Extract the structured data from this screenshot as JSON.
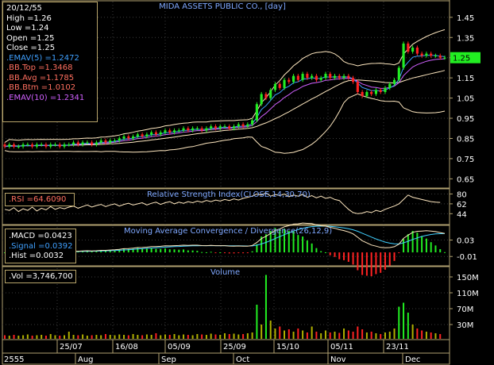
{
  "colors": {
    "background": "#000000",
    "frame": "#b0a070",
    "grid": "#3a3a3a",
    "title": "#7fa8ff",
    "candle_up": "#22ee22",
    "candle_down": "#ff2222",
    "ema5": "#3fa0ff",
    "ema10": "#d060ff",
    "bb": "#ffe8c0",
    "rsi": "#ffe8c0",
    "macd": "#ffe8c0",
    "signal": "#40d0ff",
    "hist_pos": "#22ee22",
    "hist_neg": "#ff2222",
    "vol_up": "#22ee22",
    "vol_down": "#ff2222",
    "vol_other": "#b0b000",
    "price_tag": "#22ee22"
  },
  "chart": {
    "title": "MIDA ASSETS PUBLIC CO., [day]",
    "rsi_title": "Relative Strength Index(CLOSE,14,30,70)",
    "macd_title": "Moving Average Convergence / Divergence(26,12,9)",
    "volume_title": "Volume",
    "price_tag": "1.25"
  },
  "info": {
    "date": "20/12/55",
    "high": "High  =1.26",
    "low": "Low   =1.24",
    "open": "Open  =1.25",
    "close": "Close  =1.25",
    "ema5": ".EMAV(5)    =1.2472",
    "bbtop": ".BB.Top    =1.3468",
    "bbavg": ".BB.Avg    =1.1785",
    "bbbtm": ".BB.Btm    =1.0102",
    "ema10": ".EMAV(10)  =1.2341"
  },
  "rsi_box": {
    "label": ".RSI   =64.6090"
  },
  "macd_box": {
    "macd": ".MACD  =0.0423",
    "signal": ".Signal  =0.0392",
    "hist": ".Hist  =0.0032"
  },
  "vol_box": {
    "label": ".Vol   =3,746,700"
  },
  "chart_data": {
    "type": "line",
    "price_axis": {
      "ticks": [
        "0.65",
        "0.75",
        "0.85",
        "0.95",
        "1.05",
        "1.15",
        "1.25",
        "1.35",
        "1.45"
      ],
      "ylim": [
        0.62,
        1.52
      ]
    },
    "rsi_axis": {
      "ticks": [
        "44",
        "62",
        "80"
      ],
      "ylim": [
        30,
        85
      ]
    },
    "macd_axis": {
      "ticks": [
        "-0.01",
        "0.03"
      ],
      "ylim": [
        -0.025,
        0.06
      ]
    },
    "volume_axis": {
      "ticks": [
        "30M",
        "70M",
        "110M",
        "150M"
      ],
      "ylim": [
        0,
        170
      ]
    },
    "x_date_labels": [
      "25/07",
      "16/08",
      "05/09",
      "25/09",
      "15/10",
      "05/11",
      "23/11"
    ],
    "x_month_labels": [
      "2555",
      "Aug",
      "Sep",
      "Oct",
      "Nov",
      "Dec"
    ],
    "candles": [
      {
        "o": 0.82,
        "c": 0.81
      },
      {
        "o": 0.81,
        "c": 0.82
      },
      {
        "o": 0.82,
        "c": 0.81
      },
      {
        "o": 0.81,
        "c": 0.81
      },
      {
        "o": 0.81,
        "c": 0.82
      },
      {
        "o": 0.82,
        "c": 0.82
      },
      {
        "o": 0.82,
        "c": 0.81
      },
      {
        "o": 0.81,
        "c": 0.82
      },
      {
        "o": 0.82,
        "c": 0.82
      },
      {
        "o": 0.82,
        "c": 0.81
      },
      {
        "o": 0.81,
        "c": 0.82
      },
      {
        "o": 0.82,
        "c": 0.82
      },
      {
        "o": 0.82,
        "c": 0.81
      },
      {
        "o": 0.81,
        "c": 0.82
      },
      {
        "o": 0.82,
        "c": 0.82
      },
      {
        "o": 0.82,
        "c": 0.83
      },
      {
        "o": 0.83,
        "c": 0.82
      },
      {
        "o": 0.82,
        "c": 0.83
      },
      {
        "o": 0.83,
        "c": 0.83
      },
      {
        "o": 0.83,
        "c": 0.82
      },
      {
        "o": 0.82,
        "c": 0.83
      },
      {
        "o": 0.83,
        "c": 0.84
      },
      {
        "o": 0.84,
        "c": 0.83
      },
      {
        "o": 0.83,
        "c": 0.84
      },
      {
        "o": 0.84,
        "c": 0.84
      },
      {
        "o": 0.84,
        "c": 0.85
      },
      {
        "o": 0.85,
        "c": 0.86
      },
      {
        "o": 0.86,
        "c": 0.85
      },
      {
        "o": 0.85,
        "c": 0.86
      },
      {
        "o": 0.86,
        "c": 0.87
      },
      {
        "o": 0.87,
        "c": 0.86
      },
      {
        "o": 0.86,
        "c": 0.87
      },
      {
        "o": 0.87,
        "c": 0.88
      },
      {
        "o": 0.88,
        "c": 0.87
      },
      {
        "o": 0.87,
        "c": 0.88
      },
      {
        "o": 0.88,
        "c": 0.89
      },
      {
        "o": 0.89,
        "c": 0.88
      },
      {
        "o": 0.88,
        "c": 0.89
      },
      {
        "o": 0.89,
        "c": 0.89
      },
      {
        "o": 0.89,
        "c": 0.9
      },
      {
        "o": 0.9,
        "c": 0.89
      },
      {
        "o": 0.89,
        "c": 0.9
      },
      {
        "o": 0.9,
        "c": 0.9
      },
      {
        "o": 0.9,
        "c": 0.89
      },
      {
        "o": 0.89,
        "c": 0.9
      },
      {
        "o": 0.9,
        "c": 0.91
      },
      {
        "o": 0.91,
        "c": 0.9
      },
      {
        "o": 0.9,
        "c": 0.91
      },
      {
        "o": 0.91,
        "c": 0.91
      },
      {
        "o": 0.91,
        "c": 0.9
      },
      {
        "o": 0.9,
        "c": 0.91
      },
      {
        "o": 0.91,
        "c": 0.92
      },
      {
        "o": 0.92,
        "c": 0.91
      },
      {
        "o": 0.91,
        "c": 0.92
      },
      {
        "o": 0.92,
        "c": 0.94
      },
      {
        "o": 0.94,
        "c": 1.02
      },
      {
        "o": 1.02,
        "c": 1.07
      },
      {
        "o": 1.07,
        "c": 1.05
      },
      {
        "o": 1.05,
        "c": 1.09
      },
      {
        "o": 1.09,
        "c": 1.12
      },
      {
        "o": 1.12,
        "c": 1.1
      },
      {
        "o": 1.1,
        "c": 1.14
      },
      {
        "o": 1.14,
        "c": 1.13
      },
      {
        "o": 1.13,
        "c": 1.16
      },
      {
        "o": 1.16,
        "c": 1.14
      },
      {
        "o": 1.14,
        "c": 1.17
      },
      {
        "o": 1.17,
        "c": 1.15
      },
      {
        "o": 1.15,
        "c": 1.16
      },
      {
        "o": 1.16,
        "c": 1.14
      },
      {
        "o": 1.14,
        "c": 1.15
      },
      {
        "o": 1.15,
        "c": 1.17
      },
      {
        "o": 1.17,
        "c": 1.15
      },
      {
        "o": 1.15,
        "c": 1.16
      },
      {
        "o": 1.16,
        "c": 1.15
      },
      {
        "o": 1.15,
        "c": 1.16
      },
      {
        "o": 1.16,
        "c": 1.15
      },
      {
        "o": 1.15,
        "c": 1.13
      },
      {
        "o": 1.13,
        "c": 1.08
      },
      {
        "o": 1.08,
        "c": 1.06
      },
      {
        "o": 1.06,
        "c": 1.08
      },
      {
        "o": 1.08,
        "c": 1.07
      },
      {
        "o": 1.07,
        "c": 1.09
      },
      {
        "o": 1.09,
        "c": 1.08
      },
      {
        "o": 1.08,
        "c": 1.1
      },
      {
        "o": 1.1,
        "c": 1.12
      },
      {
        "o": 1.12,
        "c": 1.14
      },
      {
        "o": 1.14,
        "c": 1.2
      },
      {
        "o": 1.2,
        "c": 1.32
      },
      {
        "o": 1.32,
        "c": 1.28
      },
      {
        "o": 1.28,
        "c": 1.3
      },
      {
        "o": 1.3,
        "c": 1.27
      },
      {
        "o": 1.27,
        "c": 1.26
      },
      {
        "o": 1.26,
        "c": 1.27
      },
      {
        "o": 1.27,
        "c": 1.26
      },
      {
        "o": 1.26,
        "c": 1.26
      },
      {
        "o": 1.26,
        "c": 1.25
      },
      {
        "o": 1.25,
        "c": 1.25
      }
    ],
    "volume_millions": [
      3,
      2,
      4,
      2,
      3,
      5,
      2,
      3,
      4,
      2,
      6,
      3,
      2,
      3,
      12,
      4,
      3,
      5,
      2,
      3,
      4,
      3,
      6,
      4,
      3,
      5,
      4,
      3,
      6,
      4,
      3,
      5,
      4,
      8,
      3,
      5,
      4,
      6,
      3,
      5,
      4,
      3,
      6,
      5,
      4,
      7,
      5,
      4,
      8,
      6,
      7,
      5,
      6,
      8,
      10,
      80,
      30,
      155,
      40,
      20,
      25,
      15,
      18,
      12,
      20,
      15,
      10,
      25,
      12,
      8,
      15,
      10,
      12,
      9,
      20,
      15,
      12,
      25,
      18,
      10,
      12,
      8,
      6,
      10,
      12,
      20,
      75,
      85,
      60,
      30,
      20,
      15,
      12,
      10,
      8,
      6
    ],
    "rsi": [
      52,
      50,
      55,
      48,
      53,
      50,
      56,
      49,
      54,
      51,
      57,
      52,
      55,
      53,
      56,
      58,
      54,
      57,
      60,
      56,
      59,
      61,
      57,
      60,
      62,
      58,
      61,
      63,
      60,
      62,
      64,
      60,
      63,
      65,
      61,
      64,
      66,
      62,
      65,
      63,
      66,
      64,
      67,
      65,
      68,
      66,
      69,
      67,
      70,
      68,
      71,
      69,
      72,
      74,
      76,
      80,
      78,
      82,
      76,
      79,
      77,
      80,
      75,
      78,
      76,
      79,
      74,
      77,
      73,
      76,
      72,
      74,
      70,
      68,
      60,
      52,
      46,
      44,
      45,
      48,
      46,
      50,
      48,
      52,
      55,
      58,
      62,
      70,
      78,
      74,
      72,
      70,
      68,
      66,
      65,
      64.6
    ]
  }
}
